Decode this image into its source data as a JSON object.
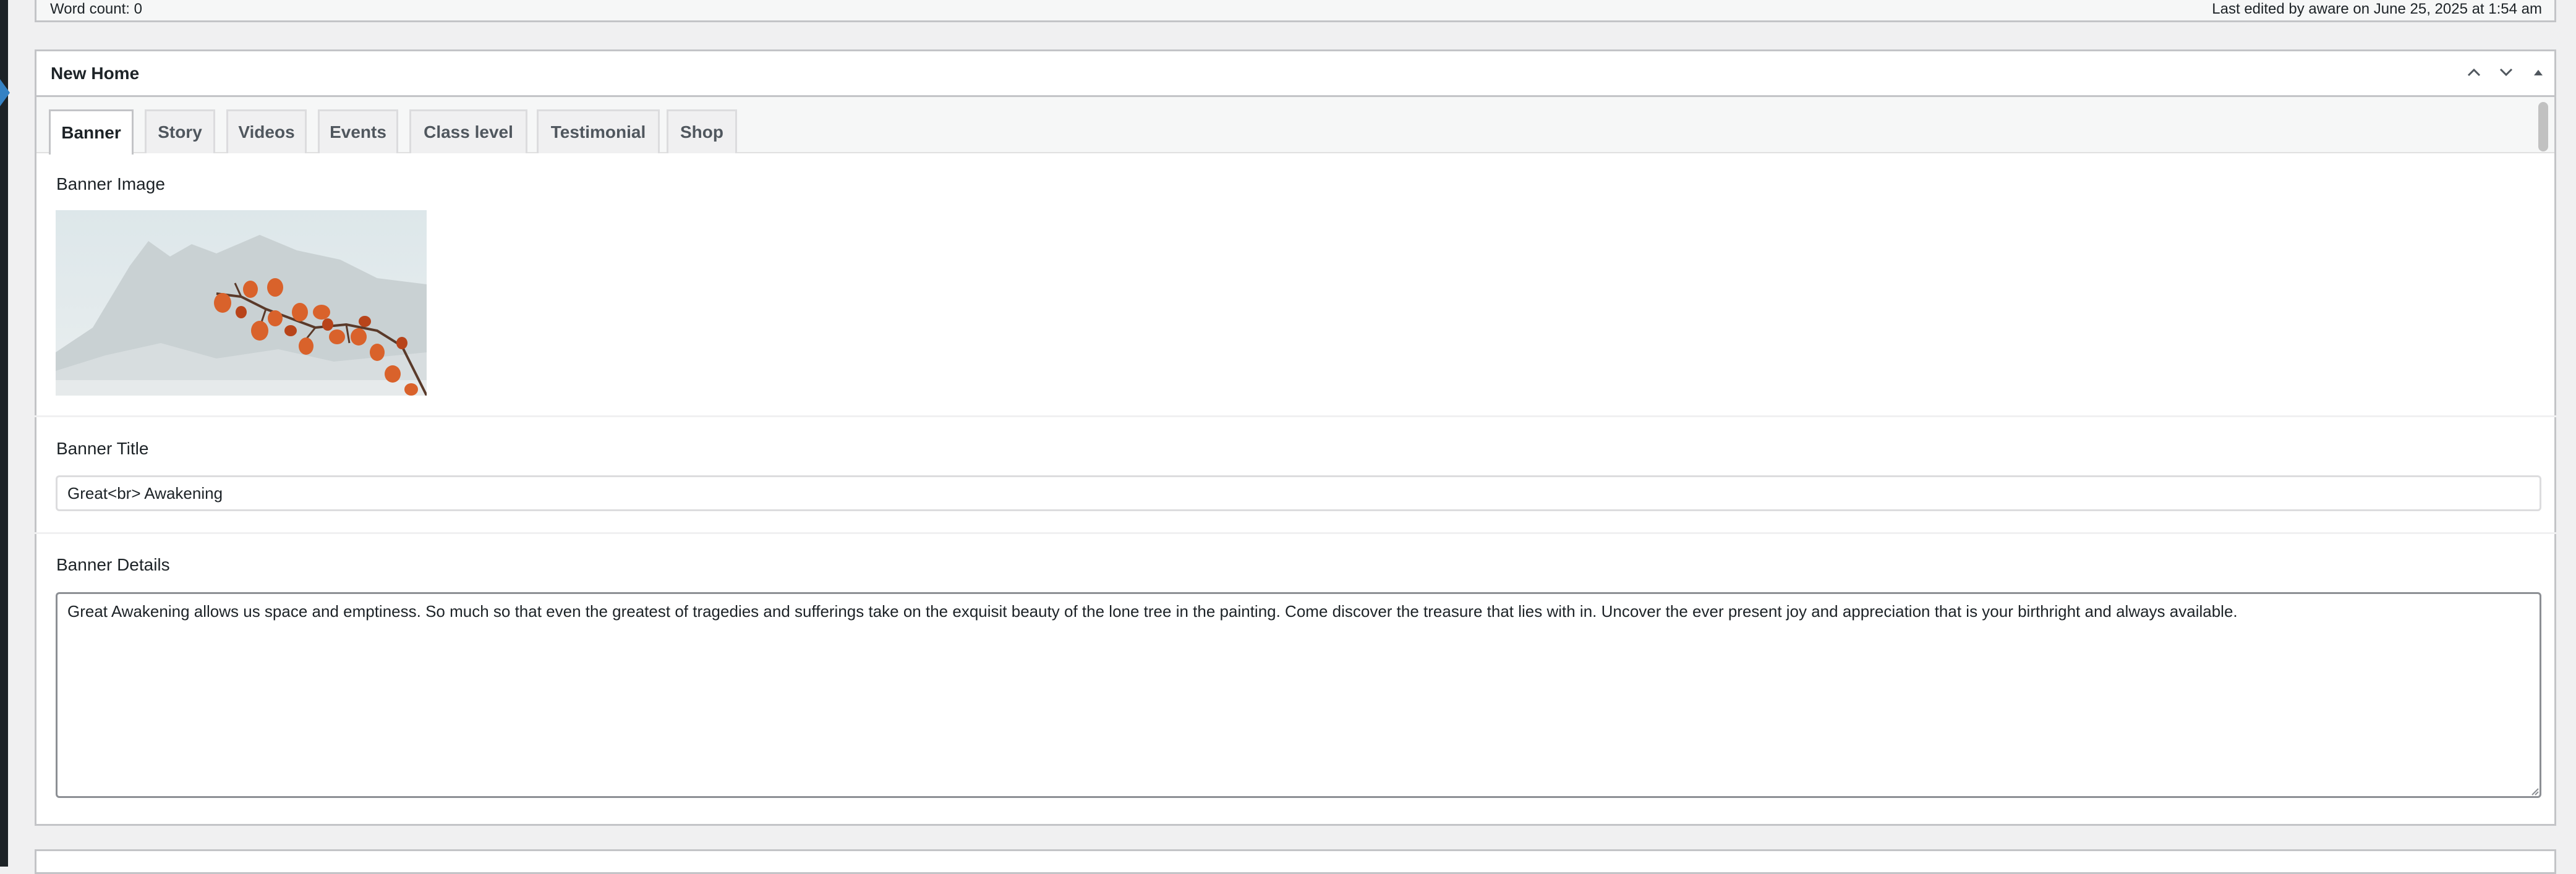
{
  "status_bar": {
    "word_count": "Word count: 0",
    "last_edited": "Last edited by aware on June 25, 2025 at 1:54 am"
  },
  "postbox": {
    "title": "New Home",
    "handle_icons": [
      "chevron-up-icon",
      "chevron-down-icon",
      "triangle-up-icon"
    ]
  },
  "tabs": [
    {
      "label": "Banner",
      "active": true
    },
    {
      "label": "Story"
    },
    {
      "label": "Videos"
    },
    {
      "label": "Events"
    },
    {
      "label": "Class level"
    },
    {
      "label": "Testimonial"
    },
    {
      "label": "Shop"
    }
  ],
  "banner": {
    "image_label": "Banner Image",
    "title_label": "Banner Title",
    "title_value": "Great<br> Awakening",
    "details_label": "Banner Details",
    "details_value": "Great Awakening allows us space and emptiness. So much so that even the greatest of tragedies and sufferings take on the exquisit beauty of the lone tree in the painting. Come discover the treasure that lies with in. Uncover the ever present joy and appreciation that is your birthright and always available."
  },
  "colors": {
    "accent": "#3582c4",
    "border": "#c3c4c7",
    "background": "#f0f0f1"
  }
}
